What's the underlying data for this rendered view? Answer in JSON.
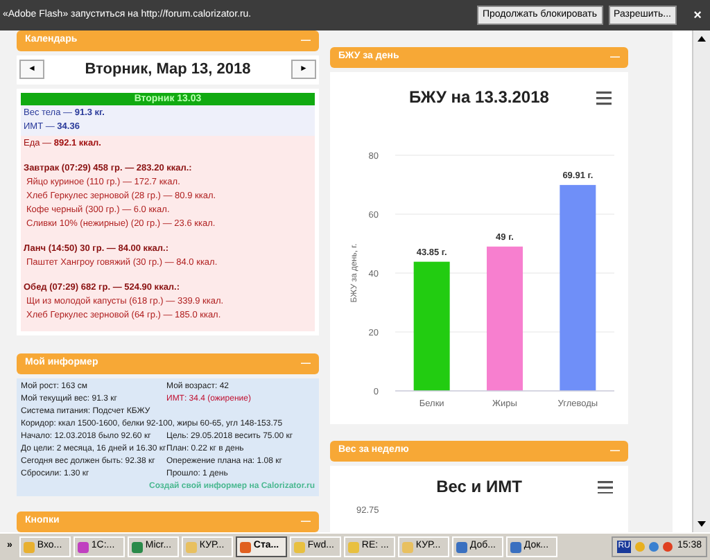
{
  "flash_bar": {
    "message": "«Adobe Flash» запуститься на http://forum.calorizator.ru.",
    "buttons": [
      "Продолжать блокировать",
      "Разрешить..."
    ],
    "close": "×"
  },
  "calendar": {
    "title": "Календарь",
    "collapse": "—",
    "prev": "◄",
    "next": "►",
    "date": "Вторник, Мар 13, 2018",
    "day_bar": "Вторник 13.03",
    "stats": [
      "Вес тела — **91.3 кг.**",
      "ИМТ — **34.36**"
    ],
    "food_total": "Еда — **892.1 ккал.**",
    "meals": [
      {
        "title": "Завтрак (07:29) 458 гр. — 283.20 ккал.:",
        "items": [
          "Яйцо куриное (110 гр.) — 172.7 ккал.",
          "Хлеб Геркулес зерновой (28 гр.) — 80.9 ккал.",
          "Кофе черный (300 гр.) — 6.0 ккал.",
          "Сливки 10% (нежирные) (20 гр.) — 23.6 ккал."
        ]
      },
      {
        "title": "Ланч (14:50) 30 гр. — 84.00 ккал.:",
        "items": [
          "Паштет Хангроу говяжий (30 гр.) — 84.0 ккал."
        ]
      },
      {
        "title": "Обед (07:29) 682 гр. — 524.90 ккал.:",
        "items": [
          "Щи из молодой капусты (618 гр.) — 339.9 ккал.",
          "Хлеб Геркулес зерновой (64 гр.) — 185.0 ккал."
        ]
      }
    ]
  },
  "informer": {
    "title": "Мой информер",
    "collapse": "—",
    "rows": [
      {
        "kind": "pair",
        "left": "Мой рост: 163 см",
        "right": "Мой возраст: 42",
        "right_alert": false
      },
      {
        "kind": "pair",
        "left": "Мой текущий вес: 91.3 кг",
        "right": "ИМТ: 34.4 (ожирение)",
        "right_alert": true
      },
      {
        "kind": "full",
        "text": "Система питания: Подсчет КБЖУ"
      },
      {
        "kind": "full",
        "text": "Коридор: ккал 1500-1600, белки 92-100, жиры 60-65, угл 148-153.75"
      },
      {
        "kind": "pair",
        "left": "Начало: 12.03.2018 было 92.60 кг",
        "right": "Цель: 29.05.2018 весить 75.00 кг",
        "right_alert": false
      },
      {
        "kind": "pair",
        "left": "До цели: 2 месяца, 16 дней и 16.30 кг",
        "right": "План: 0.22 кг в день",
        "right_alert": false
      },
      {
        "kind": "pair",
        "left": "Сегодня вес должен быть: 92.38 кг",
        "right": "Опережение плана на: 1.08 кг",
        "right_alert": false
      },
      {
        "kind": "pair",
        "left": "Сбросили: 1.30 кг",
        "right": "Прошло: 1 день",
        "right_alert": false
      }
    ],
    "link": "Создай свой информер на Calorizator.ru"
  },
  "buttons_panel": {
    "title": "Кнопки",
    "collapse": "—"
  },
  "bju_panel": {
    "title": "БЖУ за день",
    "collapse": "—",
    "chart_data": {
      "type": "bar",
      "title": "БЖУ на 13.3.2018",
      "ylabel": "БЖУ за день, г.",
      "series": [
        {
          "name": "Белки",
          "color": "#22cc11",
          "values": [
            43.85,
            null,
            null
          ]
        },
        {
          "name": "Жиры",
          "color": "#f77fcf",
          "values": [
            null,
            49,
            null
          ]
        },
        {
          "name": "Углеводы",
          "color": "#6f8ff8",
          "values": [
            null,
            null,
            69.91
          ]
        }
      ],
      "ylim": [
        0,
        80
      ],
      "yticks": [
        0,
        20,
        40,
        60,
        80
      ],
      "grid": true,
      "value_labels": [
        "43.85 г.",
        "49 г.",
        "69.91 г."
      ]
    }
  },
  "weight_panel": {
    "title": "Вес за неделю",
    "collapse": "—",
    "chart_title": "Вес и ИМТ",
    "top_tick": "92.75"
  },
  "taskbar": {
    "more": "»",
    "items": [
      {
        "label": "Вхо...",
        "selected": false
      },
      {
        "label": "1С:...",
        "selected": false
      },
      {
        "label": "Micr...",
        "selected": false
      },
      {
        "label": "КУР...",
        "selected": false
      },
      {
        "label": "Ста...",
        "selected": true
      },
      {
        "label": "Fwd...",
        "selected": false
      },
      {
        "label": "RE: ...",
        "selected": false
      },
      {
        "label": "КУР...",
        "selected": false
      },
      {
        "label": "Доб...",
        "selected": false
      },
      {
        "label": "Док...",
        "selected": false
      }
    ],
    "language": "RU",
    "clock": "15:38"
  }
}
